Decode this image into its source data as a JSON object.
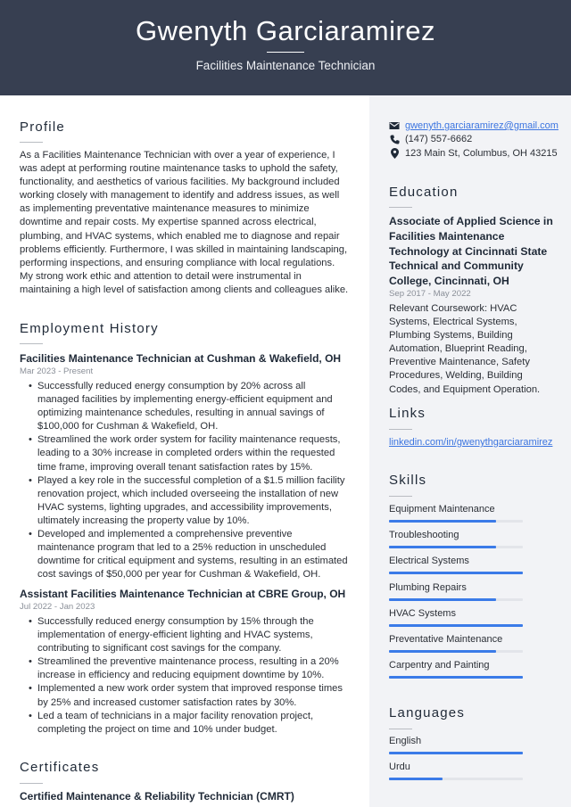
{
  "header": {
    "name": "Gwenyth Garciaramirez",
    "title": "Facilities Maintenance Technician"
  },
  "profile": {
    "heading": "Profile",
    "text": "As a Facilities Maintenance Technician with over a year of experience, I was adept at performing routine maintenance tasks to uphold the safety, functionality, and aesthetics of various facilities. My background included working closely with management to identify and address issues, as well as implementing preventative maintenance measures to minimize downtime and repair costs. My expertise spanned across electrical, plumbing, and HVAC systems, which enabled me to diagnose and repair problems efficiently. Furthermore, I was skilled in maintaining landscaping, performing inspections, and ensuring compliance with local regulations. My strong work ethic and attention to detail were instrumental in maintaining a high level of satisfaction among clients and colleagues alike."
  },
  "employment": {
    "heading": "Employment History",
    "jobs": [
      {
        "title": "Facilities Maintenance Technician at Cushman & Wakefield, OH",
        "dates": "Mar 2023 - Present",
        "bullets": [
          "Successfully reduced energy consumption by 20% across all managed facilities by implementing energy-efficient equipment and optimizing maintenance schedules, resulting in annual savings of $100,000 for Cushman & Wakefield, OH.",
          "Streamlined the work order system for facility maintenance requests, leading to a 30% increase in completed orders within the requested time frame, improving overall tenant satisfaction rates by 15%.",
          "Played a key role in the successful completion of a $1.5 million facility renovation project, which included overseeing the installation of new HVAC systems, lighting upgrades, and accessibility improvements, ultimately increasing the property value by 10%.",
          "Developed and implemented a comprehensive preventive maintenance program that led to a 25% reduction in unscheduled downtime for critical equipment and systems, resulting in an estimated cost savings of $50,000 per year for Cushman & Wakefield, OH."
        ]
      },
      {
        "title": "Assistant Facilities Maintenance Technician at CBRE Group, OH",
        "dates": "Jul 2022 - Jan 2023",
        "bullets": [
          "Successfully reduced energy consumption by 15% through the implementation of energy-efficient lighting and HVAC systems, contributing to significant cost savings for the company.",
          "Streamlined the preventive maintenance process, resulting in a 20% increase in efficiency and reducing equipment downtime by 10%.",
          "Implemented a new work order system that improved response times by 25% and increased customer satisfaction rates by 30%.",
          "Led a team of technicians in a major facility renovation project, completing the project on time and 10% under budget."
        ]
      }
    ]
  },
  "certificates": {
    "heading": "Certificates",
    "items": [
      "Certified Maintenance & Reliability Technician (CMRT)"
    ]
  },
  "contact": {
    "email": "gwenyth.garciaramirez@gmail.com",
    "phone": "(147) 557-6662",
    "address": "123 Main St, Columbus, OH 43215",
    "icons": [
      "envelope-icon",
      "phone-icon",
      "map-pin-icon"
    ]
  },
  "education": {
    "heading": "Education",
    "degree": "Associate of Applied Science in Facilities Maintenance Technology at Cincinnati State Technical and Community College, Cincinnati, OH",
    "dates": "Sep 2017 - May 2022",
    "description": "Relevant Coursework: HVAC Systems, Electrical Systems, Plumbing Systems, Building Automation, Blueprint Reading, Preventive Maintenance, Safety Procedures, Welding, Building Codes, and Equipment Operation."
  },
  "links": {
    "heading": "Links",
    "items": [
      "linkedin.com/in/gwenythgarciaramirez"
    ]
  },
  "skills": {
    "heading": "Skills",
    "items": [
      {
        "name": "Equipment Maintenance",
        "level": 0.8
      },
      {
        "name": "Troubleshooting",
        "level": 0.8
      },
      {
        "name": "Electrical Systems",
        "level": 1.0
      },
      {
        "name": "Plumbing Repairs",
        "level": 0.8
      },
      {
        "name": "HVAC Systems",
        "level": 1.0
      },
      {
        "name": "Preventative Maintenance",
        "level": 0.8
      },
      {
        "name": "Carpentry and Painting",
        "level": 1.0
      }
    ]
  },
  "languages": {
    "heading": "Languages",
    "items": [
      {
        "name": "English",
        "level": 1.0
      },
      {
        "name": "Urdu",
        "level": 0.4
      }
    ]
  },
  "colors": {
    "header_bg": "#373f51",
    "sidebar_bg": "#f2f3f6",
    "accent": "#3b7be8",
    "link": "#3b74e0"
  }
}
